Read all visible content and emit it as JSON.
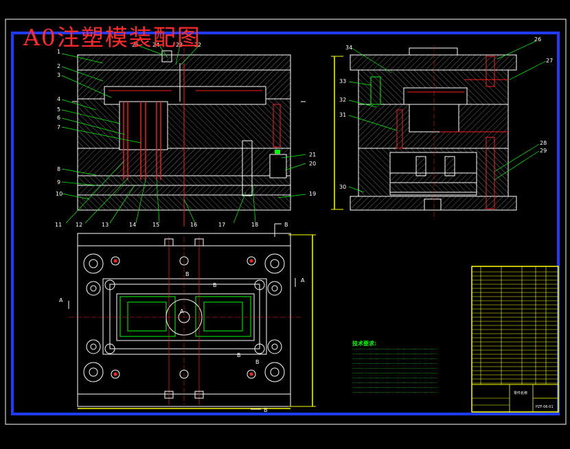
{
  "title": "A0注塑模装配图",
  "colors": {
    "background": "#000000",
    "frame": "#1e3cff",
    "outline": "#ffffff",
    "hatch": "#8a8a8a",
    "centerline": "#ff2020",
    "leader": "#00ff00",
    "dimension": "#ffff00"
  },
  "part_labels": {
    "front": [
      "1",
      "2",
      "3",
      "4",
      "5",
      "6",
      "7",
      "8",
      "9",
      "10",
      "11",
      "12",
      "13",
      "14",
      "15",
      "16",
      "17",
      "18",
      "19",
      "20",
      "21",
      "22",
      "23",
      "24",
      "25"
    ],
    "side": [
      "26",
      "27",
      "28",
      "29",
      "30",
      "31",
      "32",
      "33",
      "34"
    ]
  },
  "section_labels": {
    "a": "A",
    "b": "B"
  },
  "tech_requirements": {
    "heading": "技术要求:"
  },
  "title_block": {
    "name": "零件名称",
    "drawing_no": "PZF-06-01"
  }
}
